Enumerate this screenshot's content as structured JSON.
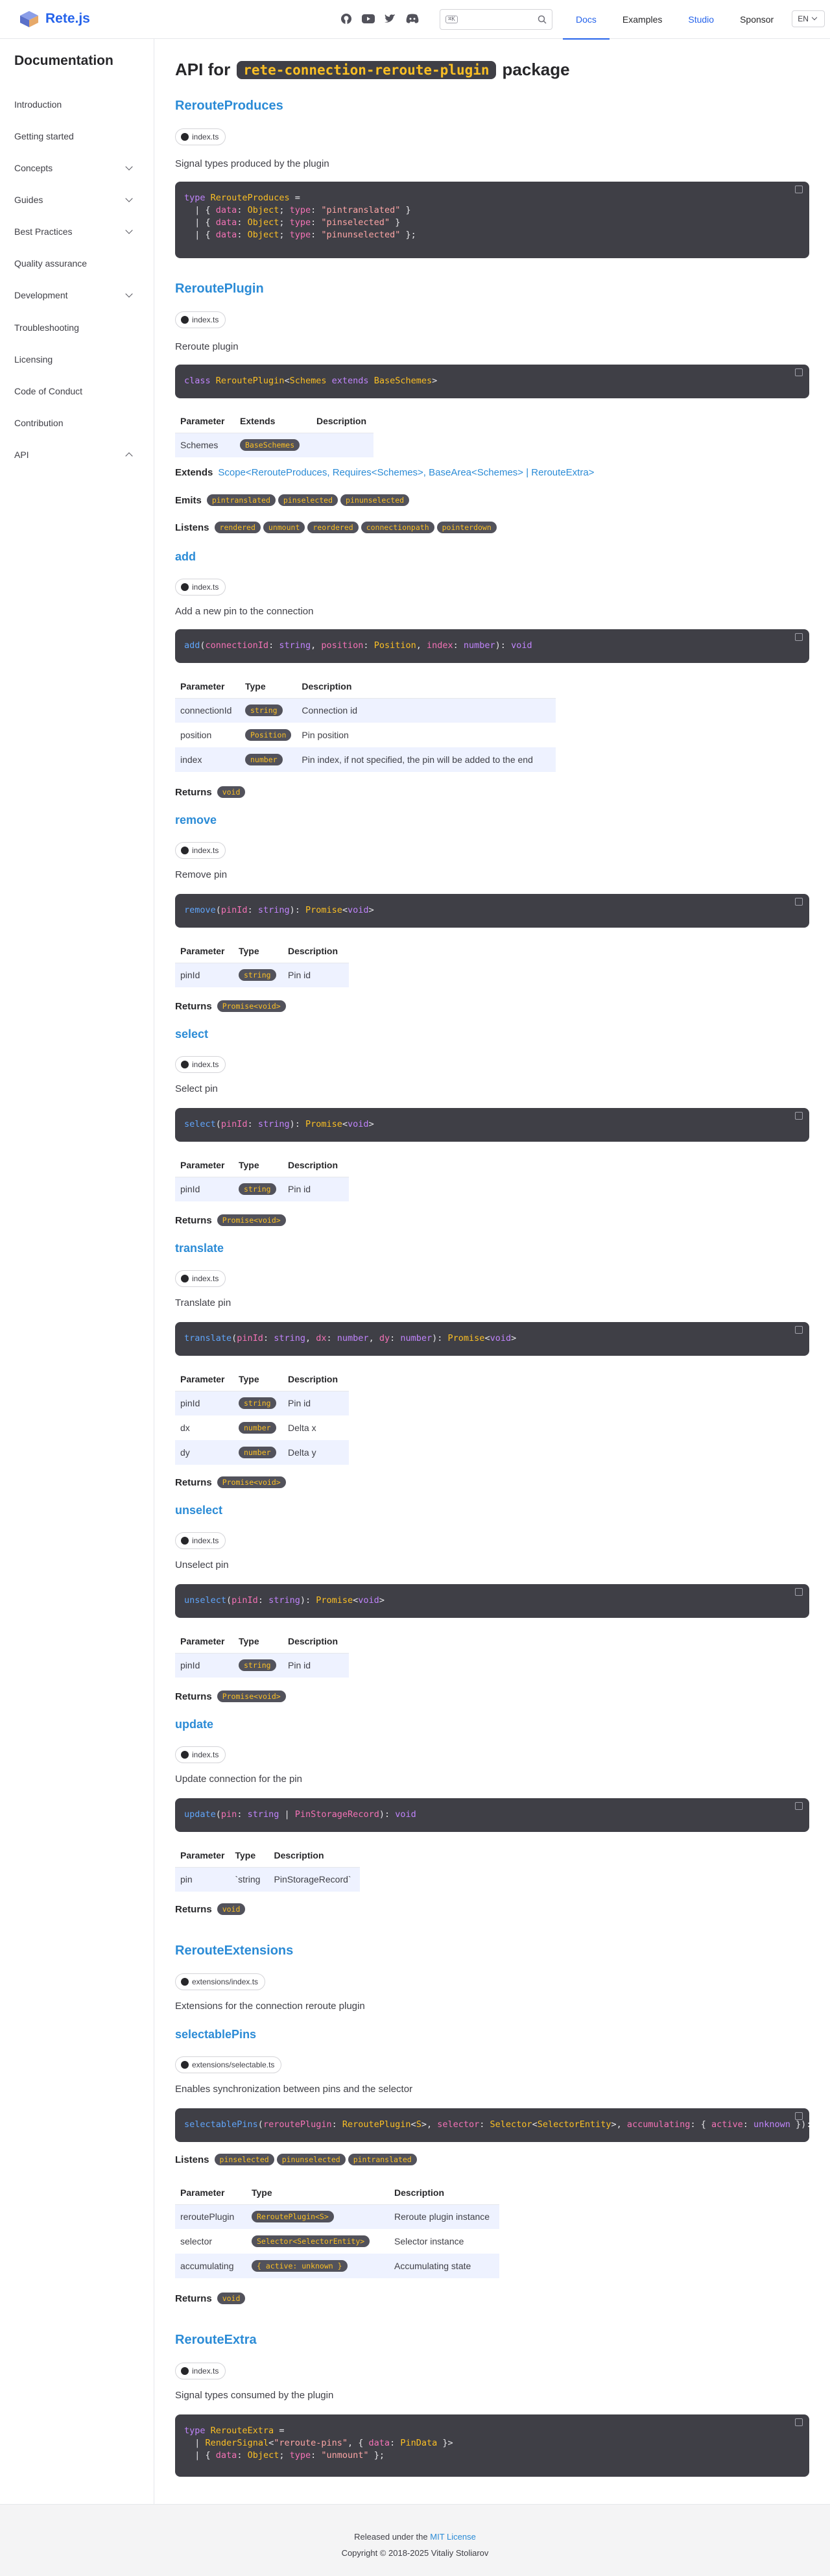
{
  "header": {
    "logo_text": "Rete.js",
    "search_kbd": "⌘K",
    "nav": [
      "Docs",
      "Examples",
      "Studio",
      "Sponsor"
    ],
    "lang": "EN",
    "icons": [
      "github-icon",
      "youtube-icon",
      "twitter-icon",
      "discord-icon"
    ]
  },
  "sidebar": {
    "title": "Documentation",
    "items": [
      {
        "label": "Introduction",
        "expandable": false
      },
      {
        "label": "Getting started",
        "expandable": false
      },
      {
        "label": "Concepts",
        "expandable": true
      },
      {
        "label": "Guides",
        "expandable": true
      },
      {
        "label": "Best Practices",
        "expandable": true
      },
      {
        "label": "Quality assurance",
        "expandable": false
      },
      {
        "label": "Development",
        "expandable": true
      },
      {
        "label": "Troubleshooting",
        "expandable": false
      },
      {
        "label": "Licensing",
        "expandable": false
      },
      {
        "label": "Code of Conduct",
        "expandable": false
      },
      {
        "label": "Contribution",
        "expandable": false
      },
      {
        "label": "API",
        "expandable": true,
        "expanded": true
      }
    ]
  },
  "page": {
    "title_prefix": "API for",
    "title_code": "rete-connection-reroute-plugin",
    "title_suffix": "package"
  },
  "labels": {
    "parameter": "Parameter",
    "type": "Type",
    "description": "Description",
    "extends": "Extends",
    "returns": "Returns",
    "emits": "Emits",
    "listens": "Listens"
  },
  "sections": {
    "produces": {
      "title": "RerouteProduces",
      "src": "index.ts",
      "desc": "Signal types produced by the plugin"
    },
    "plugin": {
      "title": "ReroutePlugin",
      "src": "index.ts",
      "desc": "Reroute plugin",
      "table": [
        {
          "name": "Schemes",
          "extends": "BaseSchemes",
          "desc": ""
        }
      ],
      "extends_parts": [
        "Scope<RerouteProduces, Requires<Schemes>, BaseArea<Schemes> | RerouteExtra>"
      ],
      "emits": [
        "pintranslated",
        "pinselected",
        "pinunselected"
      ],
      "listens": [
        "rendered",
        "unmount",
        "reordered",
        "connectionpath",
        "pointerdown"
      ]
    },
    "add": {
      "title": "add",
      "src": "index.ts",
      "desc": "Add a new pin to the connection",
      "rows": [
        {
          "name": "connectionId",
          "type": "string",
          "desc": "Connection id"
        },
        {
          "name": "position",
          "type": "Position",
          "desc": "Pin position"
        },
        {
          "name": "index",
          "type": "number",
          "desc": "Pin index, if not specified, the pin will be added to the end"
        }
      ],
      "returns": "void"
    },
    "remove": {
      "title": "remove",
      "src": "index.ts",
      "desc": "Remove pin",
      "rows": [
        {
          "name": "pinId",
          "type": "string",
          "desc": "Pin id"
        }
      ],
      "returns": "Promise<void>"
    },
    "select": {
      "title": "select",
      "src": "index.ts",
      "desc": "Select pin",
      "rows": [
        {
          "name": "pinId",
          "type": "string",
          "desc": "Pin id"
        }
      ],
      "returns": "Promise<void>"
    },
    "translate": {
      "title": "translate",
      "src": "index.ts",
      "desc": "Translate pin",
      "rows": [
        {
          "name": "pinId",
          "type": "string",
          "desc": "Pin id"
        },
        {
          "name": "dx",
          "type": "number",
          "desc": "Delta x"
        },
        {
          "name": "dy",
          "type": "number",
          "desc": "Delta y"
        }
      ],
      "returns": "Promise<void>"
    },
    "unselect": {
      "title": "unselect",
      "src": "index.ts",
      "desc": "Unselect pin",
      "rows": [
        {
          "name": "pinId",
          "type": "string",
          "desc": "Pin id"
        }
      ],
      "returns": "Promise<void>"
    },
    "update": {
      "title": "update",
      "src": "index.ts",
      "desc": "Update connection for the pin",
      "rows": [
        {
          "name": "pin",
          "type": "`string",
          "desc": "PinStorageRecord`"
        }
      ],
      "returns": "void"
    },
    "extensions": {
      "title": "RerouteExtensions",
      "src": "extensions/index.ts",
      "desc": "Extensions for the connection reroute plugin"
    },
    "selectablePins": {
      "title": "selectablePins",
      "src": "extensions/selectable.ts",
      "desc": "Enables synchronization between pins and the selector",
      "listens": [
        "pinselected",
        "pinunselected",
        "pintranslated"
      ],
      "rows": [
        {
          "name": "reroutePlugin",
          "type": "ReroutePlugin<S>",
          "desc": "Reroute plugin instance"
        },
        {
          "name": "selector",
          "type": "Selector<SelectorEntity>",
          "desc": "Selector instance"
        },
        {
          "name": "accumulating",
          "type": "{ active: unknown }",
          "desc": "Accumulating state"
        }
      ],
      "returns": "void"
    },
    "extra": {
      "title": "RerouteExtra",
      "src": "index.ts",
      "desc": "Signal types consumed by the plugin"
    }
  },
  "footer": {
    "line1_prefix": "Released under the",
    "line1_link": "MIT License",
    "line2": "Copyright © 2018-2025 Vitaliy Stoliarov"
  }
}
